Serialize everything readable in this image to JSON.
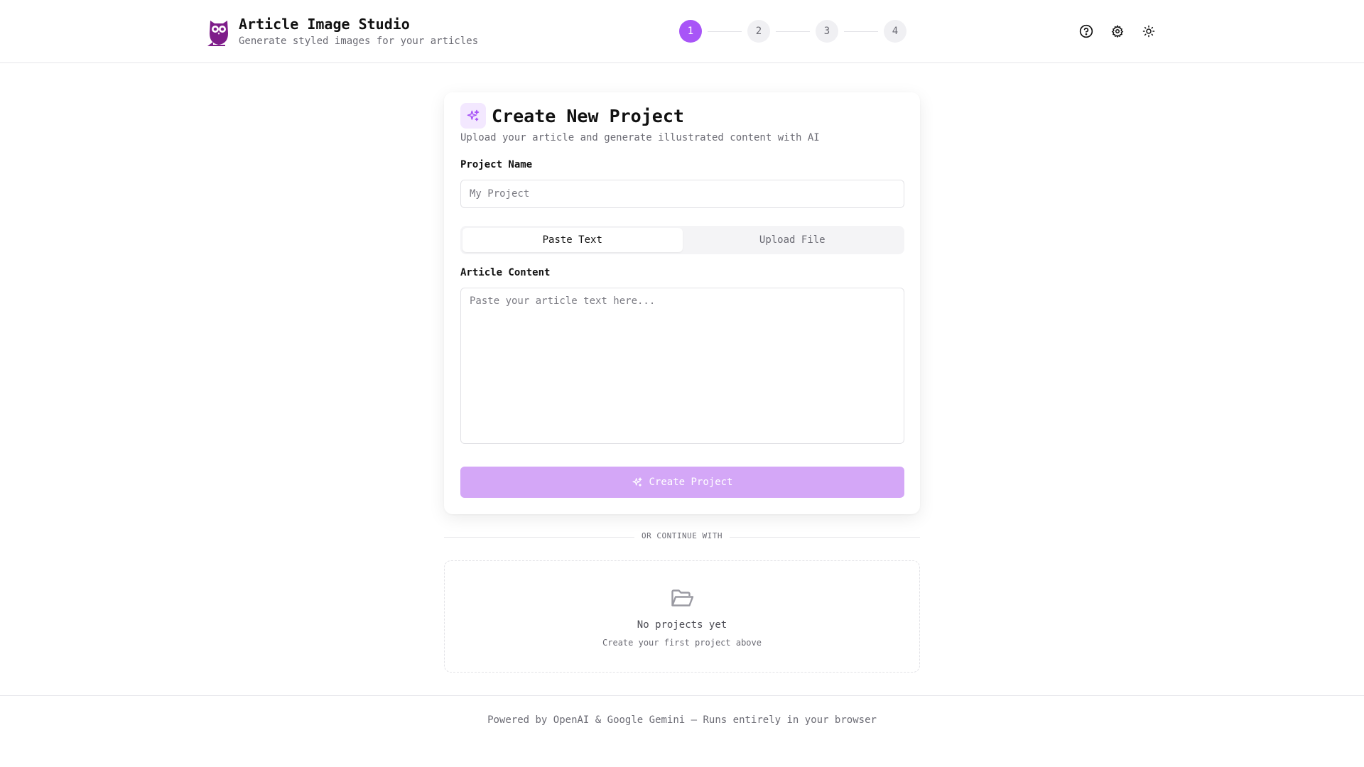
{
  "header": {
    "title": "Article Image Studio",
    "subtitle": "Generate styled images for your articles",
    "brand_color": "#7e1d8a",
    "icons": [
      "owl-logo-icon",
      "help-circle-icon",
      "gear-icon",
      "sun-icon"
    ]
  },
  "stepper": {
    "steps": [
      "1",
      "2",
      "3",
      "4"
    ],
    "active_step": "1",
    "active_color": "#a855f7"
  },
  "card": {
    "title": "Create New Project",
    "description": "Upload your article and generate illustrated content with AI",
    "project_name_label": "Project Name",
    "project_name_placeholder": "My Project",
    "project_name_value": "",
    "tabs": [
      {
        "label": "Paste Text",
        "active": true
      },
      {
        "label": "Upload File",
        "active": false
      }
    ],
    "article_content_label": "Article Content",
    "article_content_placeholder": "Paste your article text here...",
    "article_content_value": "",
    "create_button_label": "Create Project",
    "create_button_color": "#d4a7f7"
  },
  "divider": {
    "label": "OR CONTINUE WITH"
  },
  "empty_state": {
    "title": "No projects yet",
    "subtitle": "Create your first project above",
    "icon": "folder-open-icon"
  },
  "footer": {
    "text": "Powered by OpenAI & Google Gemini — Runs entirely in your browser"
  }
}
